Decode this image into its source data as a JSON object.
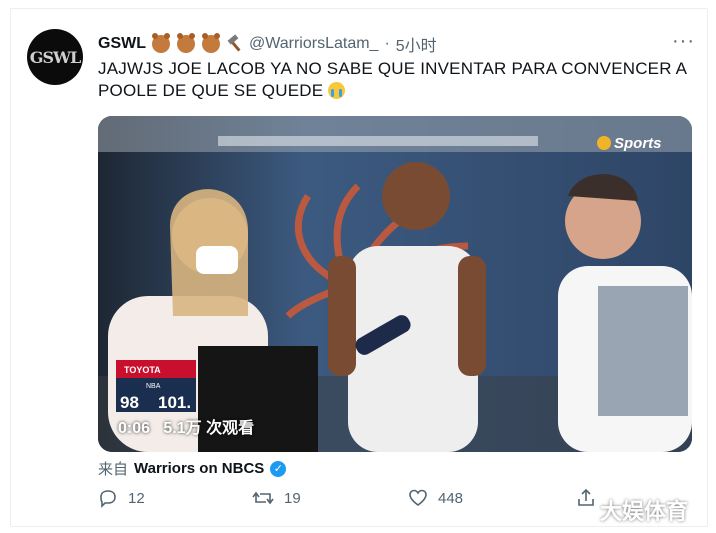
{
  "tweet": {
    "display_name": "GSWL",
    "handle": "@WarriorsLatam_",
    "separator": "·",
    "time": "5小时",
    "more": "···",
    "avatar_logo": "GSWL",
    "text": "JAJWJS JOE LACOB YA NO SABE QUE INVENTAR PARA CONVENCER A POOLE DE QUE SE QUEDE",
    "icons": [
      "bear-emoji",
      "bear-emoji",
      "bear-emoji",
      "hammer-emoji",
      "crying-emoji"
    ]
  },
  "media": {
    "network_logo": "Sports",
    "scorebug": {
      "sponsor": "TOYOTA",
      "label": "NBA",
      "score_left": "98",
      "score_right": "101."
    },
    "video_time": "0:06",
    "views": "5.1万 次观看"
  },
  "source": {
    "prefix": "来自",
    "name": "Warriors on NBCS"
  },
  "actions": {
    "replies": "12",
    "retweets": "19",
    "likes": "448"
  },
  "watermark": "大娱体育",
  "colors": {
    "text": "#0f1419",
    "secondary": "#536471",
    "verified": "#1d9bf0"
  }
}
